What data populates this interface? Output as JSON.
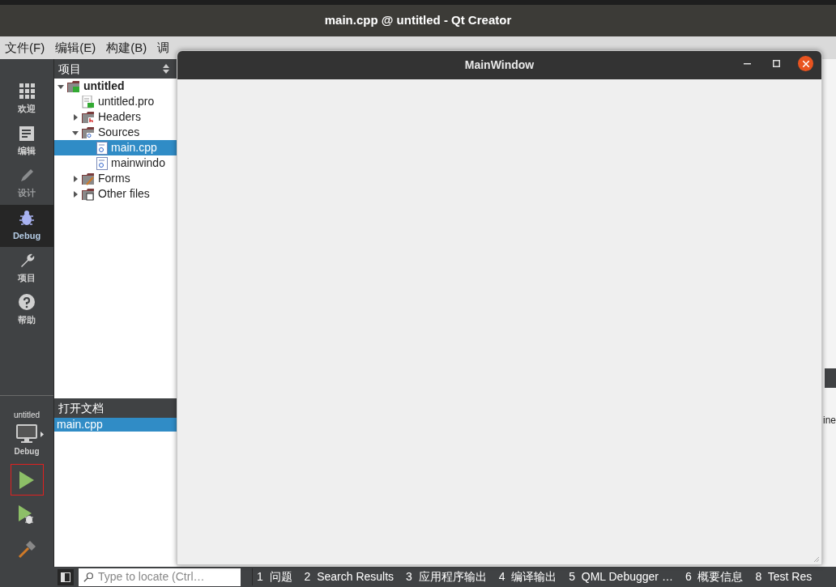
{
  "window": {
    "title": "main.cpp @ untitled - Qt Creator"
  },
  "menu": [
    "文件(F)",
    "编辑(E)",
    "构建(B)",
    "调"
  ],
  "modes": [
    {
      "label": "欢迎",
      "kind": "welcome",
      "selected": false,
      "disabled": false
    },
    {
      "label": "编辑",
      "kind": "edit",
      "selected": false,
      "disabled": false
    },
    {
      "label": "设计",
      "kind": "design",
      "selected": false,
      "disabled": true
    },
    {
      "label": "Debug",
      "kind": "debug",
      "selected": true,
      "disabled": false
    },
    {
      "label": "项目",
      "kind": "projects",
      "selected": false,
      "disabled": false
    },
    {
      "label": "帮助",
      "kind": "help",
      "selected": false,
      "disabled": false
    }
  ],
  "project_panel": {
    "title": "项目",
    "tree": [
      {
        "label": "untitled",
        "kind": "project",
        "expanded": true,
        "selected": false,
        "children": [
          {
            "label": "untitled.pro",
            "kind": "pro",
            "selected": false
          },
          {
            "label": "Headers",
            "kind": "headers",
            "expanded": false,
            "selected": false
          },
          {
            "label": "Sources",
            "kind": "sources",
            "expanded": true,
            "selected": false,
            "children": [
              {
                "label": "main.cpp",
                "kind": "cpp",
                "selected": true
              },
              {
                "label": "mainwindo",
                "kind": "cpp",
                "selected": false
              }
            ]
          },
          {
            "label": "Forms",
            "kind": "forms",
            "expanded": false,
            "selected": false
          },
          {
            "label": "Other files",
            "kind": "other",
            "expanded": false,
            "selected": false
          }
        ]
      }
    ]
  },
  "open_documents": {
    "title": "打开文档",
    "items": [
      {
        "label": "main.cpp",
        "selected": true
      }
    ]
  },
  "kit": {
    "project": "untitled",
    "build": "Debug"
  },
  "run_buttons": [
    {
      "kind": "run",
      "highlighted": true
    },
    {
      "kind": "debug",
      "highlighted": false
    },
    {
      "kind": "build",
      "highlighted": false
    }
  ],
  "locator": {
    "placeholder": "Type to locate (Ctrl…"
  },
  "output_tabs": [
    "1  问题",
    "2  Search Results",
    "3  应用程序输出",
    "4  编译输出",
    "5  QML Debugger …",
    "6  概要信息",
    "8  Test Res"
  ],
  "editor_fragment": "ine",
  "dialog": {
    "title": "MainWindow"
  }
}
